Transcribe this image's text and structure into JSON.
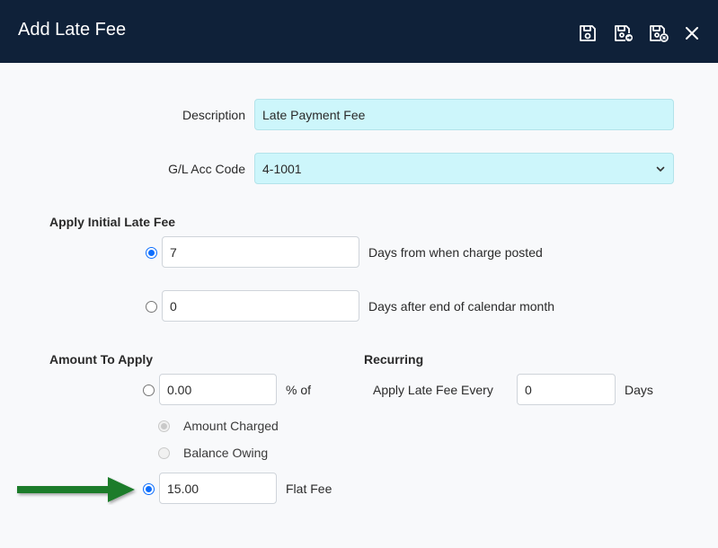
{
  "header": {
    "title": "Add Late Fee",
    "icons": [
      "save-icon",
      "save-and-new-icon",
      "save-and-close-icon",
      "close-icon"
    ]
  },
  "form": {
    "description_label": "Description",
    "description_value": "Late Payment Fee",
    "gl_label": "G/L Acc Code",
    "gl_value": "4-1001",
    "initial_section": "Apply Initial Late Fee",
    "days_from_posted_value": "7",
    "days_from_posted_label": "Days from when charge posted",
    "days_after_month_value": "0",
    "days_after_month_label": "Days after end of calendar month",
    "amount_section": "Amount To Apply",
    "percent_value": "0.00",
    "percent_label": "% of",
    "amount_charged_label": "Amount Charged",
    "balance_owing_label": "Balance Owing",
    "flat_fee_value": "15.00",
    "flat_fee_label": "Flat Fee",
    "recurring_section": "Recurring",
    "apply_every_label": "Apply Late Fee Every",
    "apply_every_value": "0",
    "days_label": "Days"
  },
  "colors": {
    "header_bg": "#0f2139",
    "field_highlight": "#cdf6fb",
    "radio_selected": "#0d6efd",
    "arrow": "#1e7b2a"
  }
}
